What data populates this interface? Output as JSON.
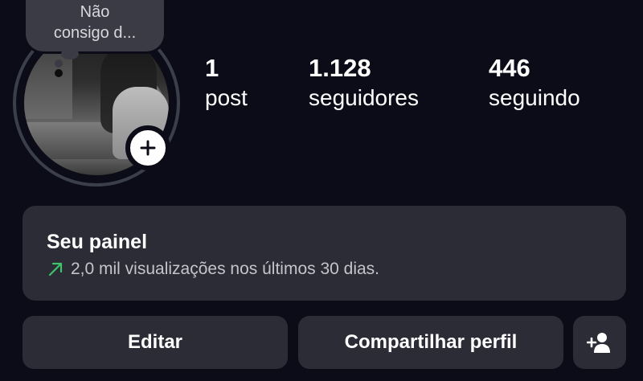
{
  "profile": {
    "note": "Não\nconsigo d...",
    "stats": {
      "posts": {
        "value": "1",
        "label": "post"
      },
      "followers": {
        "value": "1.128",
        "label": "seguidores"
      },
      "following": {
        "value": "446",
        "label": "seguindo"
      }
    }
  },
  "dashboard": {
    "title": "Seu painel",
    "subtitle": "2,0 mil visualizações nos últimos 30 dias.",
    "trend_color": "#3cc46d"
  },
  "actions": {
    "edit_label": "Editar",
    "share_label": "Compartilhar perfil"
  },
  "icons": {
    "add_story": "plus-icon",
    "trend": "trending-up-arrow-icon",
    "add_user": "person-add-icon"
  },
  "colors": {
    "background": "#0c0c18",
    "card": "#2b2c35",
    "note_bubble": "#3a3b44"
  }
}
